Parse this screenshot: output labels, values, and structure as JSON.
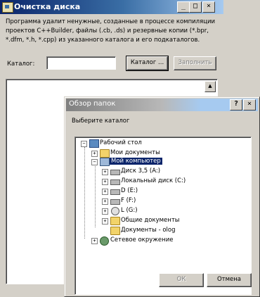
{
  "main_window": {
    "title": "Очистка диска",
    "description": "Программа удалит ненужные, созданные в процессе компиляции проектов C++Builder, файлы (.cb, .ds) и резервные копии (*.bpr, *.dfm, *.h, *.cpp) из указанного каталога и его подкаталогов.",
    "catalog_label": "Каталог:",
    "catalog_value": "",
    "browse_button": "Каталог ...",
    "fill_button": "Заполнить"
  },
  "dialog": {
    "title": "Обзор папок",
    "help_glyph": "?",
    "close_glyph": "×",
    "prompt": "Выберите каталог",
    "tree": {
      "desktop": "Рабочий стол",
      "my_documents": "Мои документы",
      "my_computer": "Мой компьютер",
      "drive_a": "Диск 3,5 (A:)",
      "drive_c": "Локальный диск (C:)",
      "drive_d": "D (E:)",
      "drive_e": "F (F:)",
      "drive_g": "L (G:)",
      "shared_docs": "Общие документы",
      "user_docs": "Документы - olog",
      "network": "Сетевое окружение"
    },
    "ok_button": "ОК",
    "cancel_button": "Отмена"
  },
  "window_controls": {
    "minimize": "_",
    "maximize": "□",
    "close": "×"
  },
  "colors": {
    "active_title": "#0a246a",
    "face": "#d4d0c8",
    "selection": "#0a246a"
  }
}
